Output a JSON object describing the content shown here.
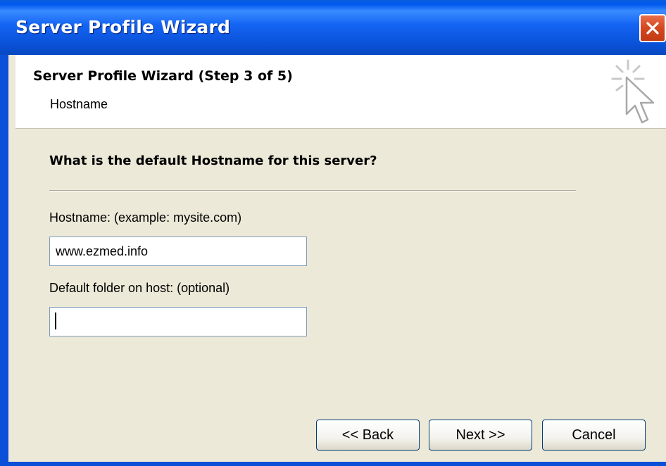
{
  "window": {
    "title": "Server Profile Wizard"
  },
  "header": {
    "step_title": "Server Profile Wizard (Step 3 of 5)",
    "step_subtitle": "Hostname"
  },
  "main": {
    "question": "What is the default Hostname for this server?",
    "hostname": {
      "label": "Hostname: (example: mysite.com)",
      "value": "www.ezmed.info"
    },
    "folder": {
      "label": "Default folder on host: (optional)",
      "value": ""
    }
  },
  "buttons": {
    "back": "<< Back",
    "next": "Next >>",
    "cancel": "Cancel"
  },
  "icons": {
    "close": "close-icon",
    "wizard": "wizard-cursor-icon"
  },
  "colors": {
    "titlebar": "#0a52d8",
    "dialog_bg": "#ece9d8",
    "close_button": "#d4471f"
  }
}
